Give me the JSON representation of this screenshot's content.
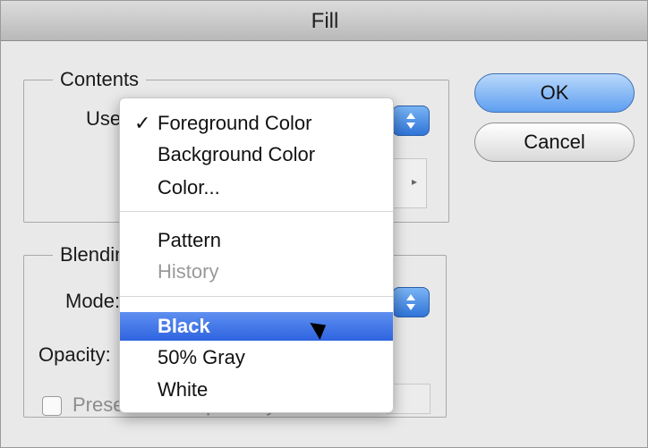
{
  "window": {
    "title": "Fill"
  },
  "contents": {
    "legend": "Contents",
    "use_label": "Use:"
  },
  "blending": {
    "legend": "Blending",
    "mode_label": "Mode:",
    "opacity_label": "Opacity:",
    "preserve_label": "Preserve Transparency"
  },
  "buttons": {
    "ok": "OK",
    "cancel": "Cancel"
  },
  "menu": {
    "checked_item": "Foreground Color",
    "items": [
      {
        "label": "Foreground Color",
        "checked": true,
        "enabled": true
      },
      {
        "label": "Background Color",
        "checked": false,
        "enabled": true
      },
      {
        "label": "Color...",
        "checked": false,
        "enabled": true
      },
      {
        "label": "Pattern",
        "checked": false,
        "enabled": true
      },
      {
        "label": "History",
        "checked": false,
        "enabled": false
      },
      {
        "label": "Black",
        "checked": false,
        "enabled": true,
        "selected": true
      },
      {
        "label": "50% Gray",
        "checked": false,
        "enabled": true
      },
      {
        "label": "White",
        "checked": false,
        "enabled": true
      }
    ]
  },
  "colors": {
    "accent": "#2f64e0",
    "window_bg": "#e9e9e9"
  },
  "icons": {
    "check": "checkmark-icon",
    "cursor": "mouse-pointer-icon",
    "popup_arrows": "updown-arrows-icon"
  }
}
